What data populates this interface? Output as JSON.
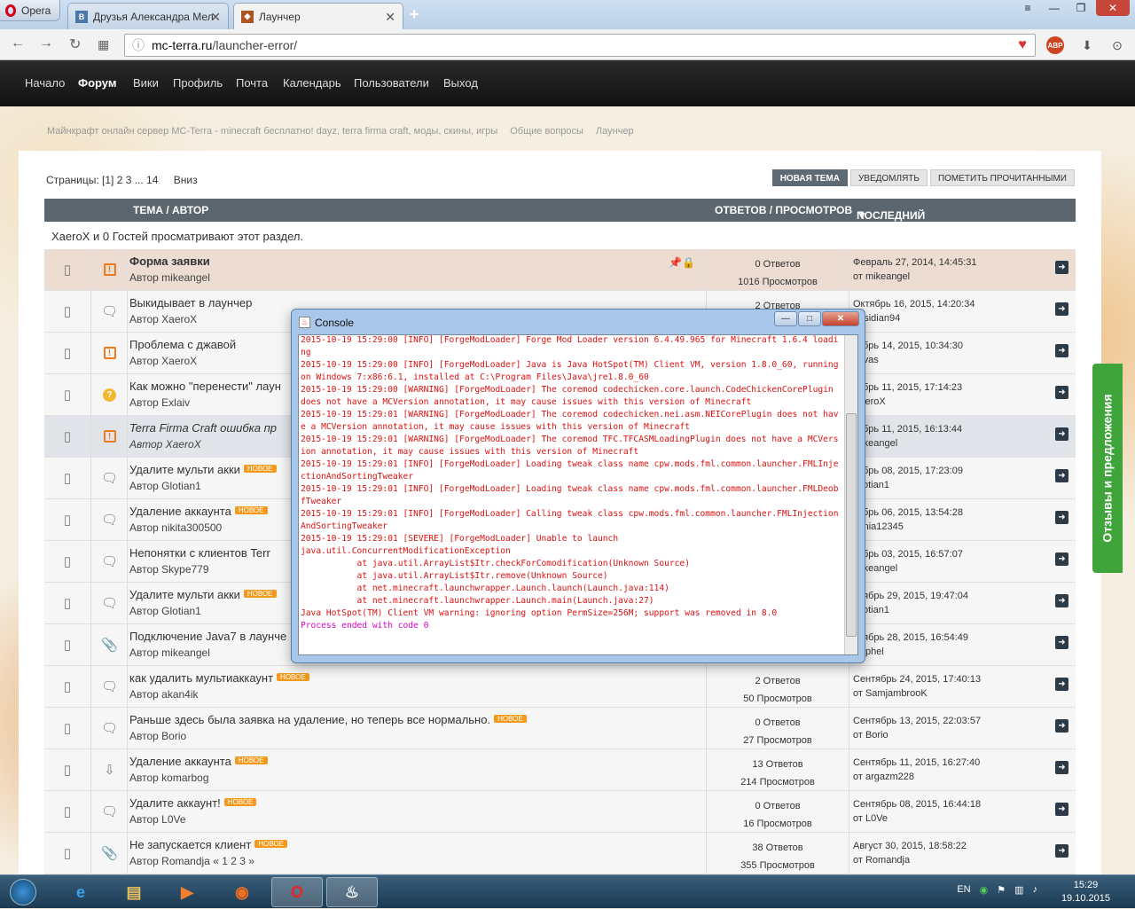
{
  "browser": {
    "menu_label": "Opera",
    "tabs": [
      {
        "label": "Друзья Александра Мел",
        "icon": "vk-icon"
      },
      {
        "label": "Лаунчер",
        "icon": "mc-terra-icon"
      }
    ],
    "url_host": "mc-terra.ru",
    "url_path": "/launcher-error/",
    "abp_label": "ABP",
    "abp_count": "1"
  },
  "site_nav": [
    "Начало",
    "Форум",
    "Вики",
    "Профиль",
    "Почта",
    "Календарь",
    "Пользователи",
    "Выход"
  ],
  "breadcrumb": [
    "Майнкрафт онлайн сервер MC-Terra - minecraft бесплатно! dayz, terra firma craft, моды, скины, игры",
    "Общие вопросы",
    "Лаунчер"
  ],
  "pagination": {
    "label": "Страницы:",
    "current": "[1]",
    "pages": "2 3 ... 14",
    "down": "Вниз"
  },
  "actions": [
    "НОВАЯ ТЕМА",
    "УВЕДОМЛЯТЬ",
    "ПОМЕТИТЬ ПРОЧИТАННЫМИ"
  ],
  "table_header": {
    "topic": "ТЕМА / АВТОР",
    "stats": "ОТВЕТОВ / ПРОСМОТРОВ",
    "last": "ПОСЛЕДНИЙ ОТВЕТ"
  },
  "viewers": "XaeroX и 0 Гостей просматривают этот раздел.",
  "new_badge": "НОВОЕ",
  "topics": [
    {
      "title": "Форма заявки",
      "author": "Автор mikeangel",
      "replies": "0 Ответов",
      "views": "1016 Просмотров",
      "last_date": "Февраль 27, 2014, 14:45:31",
      "last_by": "от mikeangel",
      "kind": "sticky",
      "icon": "excl",
      "new": false
    },
    {
      "title": "Выкидывает в лаунчер",
      "author": "Автор XaeroX",
      "replies": "2 Ответов",
      "views": "",
      "last_date": "Октябрь 16, 2015, 14:20:34",
      "last_by": "obsidian94",
      "kind": "",
      "icon": "bubble",
      "new": false
    },
    {
      "title": "Проблема с джавой",
      "author": "Автор XaeroX",
      "replies": "",
      "views": "",
      "last_date": "тябрь 14, 2015, 10:34:30",
      "last_by": "vavas",
      "kind": "",
      "icon": "excl",
      "new": false
    },
    {
      "title": "Как можно \"перенести\" лаун",
      "author": "Автор Exlaiv",
      "replies": "",
      "views": "",
      "last_date": "тябрь 11, 2015, 17:14:23",
      "last_by": "XaeroX",
      "kind": "",
      "icon": "q",
      "new": false
    },
    {
      "title": "Terra Firma Craft ошибка пр",
      "author": "Автор XaeroX",
      "replies": "",
      "views": "",
      "last_date": "тябрь 11, 2015, 16:13:44",
      "last_by": "mikeangel",
      "kind": "locked",
      "icon": "excl",
      "new": false
    },
    {
      "title": "Удалите мульти акки",
      "author": "Автор Glotian1",
      "replies": "",
      "views": "",
      "last_date": "тябрь 08, 2015, 17:23:09",
      "last_by": "Glotian1",
      "kind": "",
      "icon": "bubble",
      "new": true
    },
    {
      "title": "Удаление аккаунта",
      "author": "Автор nikita300500",
      "replies": "",
      "views": "",
      "last_date": "тябрь 06, 2015, 13:54:28",
      "last_by": "sania12345",
      "kind": "",
      "icon": "bubble",
      "new": true
    },
    {
      "title": "Непонятки с клиентов Terr",
      "author": "Автор Skype779",
      "replies": "",
      "views": "",
      "last_date": "тябрь 03, 2015, 16:57:07",
      "last_by": "mikeangel",
      "kind": "",
      "icon": "bubble",
      "new": false
    },
    {
      "title": "Удалите мульти акки",
      "author": "Автор Glotian1",
      "replies": "",
      "views": "",
      "last_date": "нтябрь 29, 2015, 19:47:04",
      "last_by": "Glotian1",
      "kind": "",
      "icon": "bubble",
      "new": true
    },
    {
      "title": "Подключение Java7 в лаунче",
      "author": "Автор mikeangel",
      "replies": "",
      "views": "",
      "last_date": "нтябрь 28, 2015, 16:54:49",
      "last_by": "Caphel",
      "kind": "",
      "icon": "clip",
      "new": false
    },
    {
      "title": "как удалить мультиаккаунт",
      "author": "Автор akan4ik",
      "replies": "2 Ответов",
      "views": "50 Просмотров",
      "last_date": "Сентябрь 24, 2015, 17:40:13",
      "last_by": "от SamjambrooK",
      "kind": "",
      "icon": "bubble",
      "new": true
    },
    {
      "title": "Раньше здесь была заявка на удаление, но теперь все нормально.",
      "author": "Автор Borio",
      "replies": "0 Ответов",
      "views": "27 Просмотров",
      "last_date": "Сентябрь 13, 2015, 22:03:57",
      "last_by": "от Borio",
      "kind": "",
      "icon": "bubble",
      "new": true
    },
    {
      "title": "Удаление аккаунта",
      "author": "Автор komarbog",
      "replies": "13 Ответов",
      "views": "214 Просмотров",
      "last_date": "Сентябрь 11, 2015, 16:27:40",
      "last_by": "от argazm228",
      "kind": "",
      "icon": "thumb",
      "new": true
    },
    {
      "title": "Удалите аккаунт!",
      "author": "Автор L0Ve",
      "replies": "0 Ответов",
      "views": "16 Просмотров",
      "last_date": "Сентябрь 08, 2015, 16:44:18",
      "last_by": "от L0Ve",
      "kind": "",
      "icon": "bubble",
      "new": true
    },
    {
      "title": "Не запускается клиент",
      "author": "Автор Romandja « 1 2 3 »",
      "replies": "38 Ответов",
      "views": "355 Просмотров",
      "last_date": "Август 30, 2015, 18:58:22",
      "last_by": "от Romandja",
      "kind": "",
      "icon": "clip",
      "new": true
    }
  ],
  "feedback_label": "Отзывы и предложения",
  "console": {
    "title": "Console",
    "lines": [
      "2015-10-19 15:29:00 [INFO] [ForgeModLoader] Forge Mod Loader version 6.4.49.965 for Minecraft 1.6.4 loading",
      "2015-10-19 15:29:00 [INFO] [ForgeModLoader] Java is Java HotSpot(TM) Client VM, version 1.8.0_60, running on Windows 7:x86:6.1, installed at C:\\Program Files\\Java\\jre1.8.0_60",
      "2015-10-19 15:29:00 [WARNING] [ForgeModLoader] The coremod codechicken.core.launch.CodeChickenCorePlugin does not have a MCVersion annotation, it may cause issues with this version of Minecraft",
      "2015-10-19 15:29:01 [WARNING] [ForgeModLoader] The coremod codechicken.nei.asm.NEICorePlugin does not have a MCVersion annotation, it may cause issues with this version of Minecraft",
      "2015-10-19 15:29:01 [WARNING] [ForgeModLoader] The coremod TFC.TFCASMLoadingPlugin does not have a MCVersion annotation, it may cause issues with this version of Minecraft",
      "2015-10-19 15:29:01 [INFO] [ForgeModLoader] Loading tweak class name cpw.mods.fml.common.launcher.FMLInjectionAndSortingTweaker",
      "2015-10-19 15:29:01 [INFO] [ForgeModLoader] Loading tweak class name cpw.mods.fml.common.launcher.FMLDeobfTweaker",
      "2015-10-19 15:29:01 [INFO] [ForgeModLoader] Calling tweak class cpw.mods.fml.common.launcher.FMLInjectionAndSortingTweaker",
      "2015-10-19 15:29:01 [SEVERE] [ForgeModLoader] Unable to launch",
      "java.util.ConcurrentModificationException",
      "           at java.util.ArrayList$Itr.checkForComodification(Unknown Source)",
      "           at java.util.ArrayList$Itr.remove(Unknown Source)",
      "           at net.minecraft.launchwrapper.Launch.launch(Launch.java:114)",
      "           at net.minecraft.launchwrapper.Launch.main(Launch.java:27)",
      "Java HotSpot(TM) Client VM warning: ignoring option PermSize=256M; support was removed in 8.0"
    ],
    "end_line": "Process ended with code 0"
  },
  "taskbar": {
    "lang": "EN",
    "time": "15:29",
    "date": "19.10.2015"
  },
  "colors": {
    "accent_green": "#3fa53a",
    "header_gray": "#5b666e",
    "log_red": "#d11",
    "badge_orange": "#f39a1c"
  }
}
